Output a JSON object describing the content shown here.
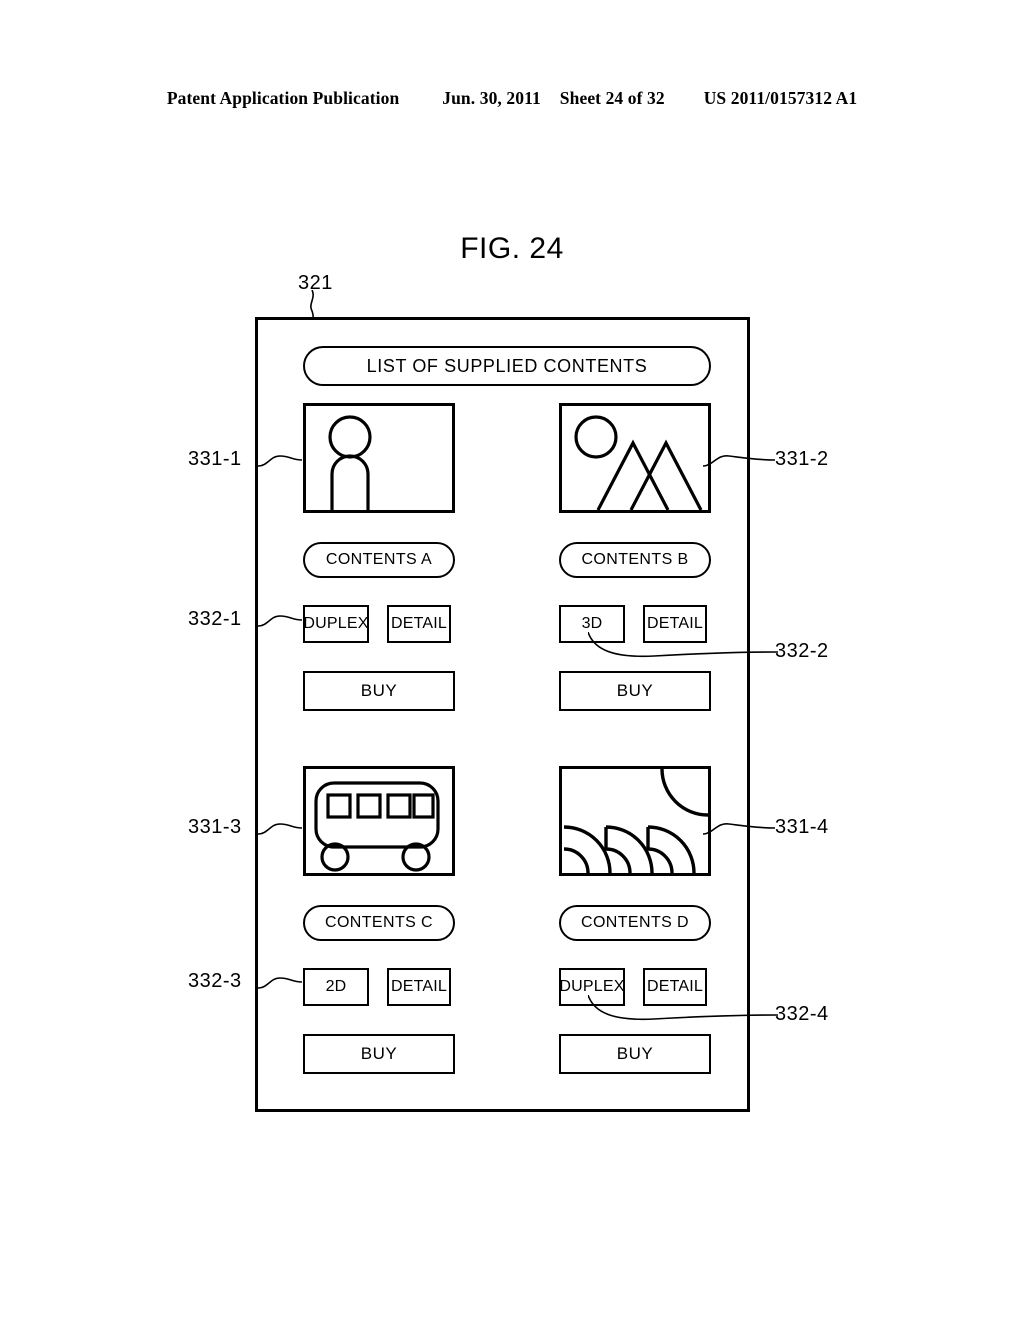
{
  "header": {
    "publication": "Patent Application Publication",
    "date": "Jun. 30, 2011",
    "sheet": "Sheet 24 of 32",
    "patent_number": "US 2011/0157312 A1"
  },
  "figure": {
    "title": "FIG. 24",
    "screen_ref": "321"
  },
  "screen": {
    "list_title": "LIST OF SUPPLIED CONTENTS"
  },
  "contents": [
    {
      "thumb_icon": "person-icon",
      "thumb_ref": "331-1",
      "title": "CONTENTS A",
      "format_label": "DUPLEX",
      "detail_label": "DETAIL",
      "buy_label": "BUY",
      "button_ref": "332-1"
    },
    {
      "thumb_icon": "landscape-icon",
      "thumb_ref": "331-2",
      "title": "CONTENTS B",
      "format_label": "3D",
      "detail_label": "DETAIL",
      "buy_label": "BUY",
      "button_ref": "332-2"
    },
    {
      "thumb_icon": "bus-icon",
      "thumb_ref": "331-3",
      "title": "CONTENTS C",
      "format_label": "2D",
      "detail_label": "DETAIL",
      "buy_label": "BUY",
      "button_ref": "332-3"
    },
    {
      "thumb_icon": "abstract-arcs-icon",
      "thumb_ref": "331-4",
      "title": "CONTENTS D",
      "format_label": "DUPLEX",
      "detail_label": "DETAIL",
      "buy_label": "BUY",
      "button_ref": "332-4"
    }
  ],
  "colors": {
    "line": "#000000",
    "background": "#ffffff"
  }
}
